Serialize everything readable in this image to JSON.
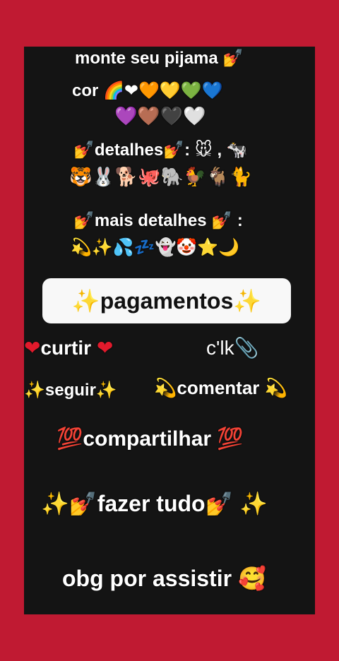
{
  "colors": {
    "background": "#c01a32",
    "panel": "#141414",
    "pill": "#f8f8f8",
    "text": "#ffffff"
  },
  "title": "monte seu pijama 💅",
  "cor_line1": "cor 🌈❤🧡💛💚💙",
  "cor_line2": "💜🤎🖤🤍",
  "detalhes_line1": "💅detalhes💅: 🐭 , 🐄",
  "detalhes_line2": "🐯🐰🐕🐙🐘🐓🐐🐈",
  "mais_detalhes_line1": "💅mais detalhes 💅 :",
  "mais_detalhes_line2": "💫✨💦💤👻🤡⭐🌙",
  "pagamentos": "✨pagamentos✨",
  "curtir": {
    "left_icon": "❤",
    "label": "curtir",
    "right_icon": "❤"
  },
  "clk": "c'lk📎",
  "seguir": "✨seguir✨",
  "comentar": "💫comentar 💫",
  "compartilhar": "💯compartilhar 💯",
  "fazer_tudo": "✨💅fazer tudo💅 ✨",
  "obg": "obg por assistir 🥰"
}
